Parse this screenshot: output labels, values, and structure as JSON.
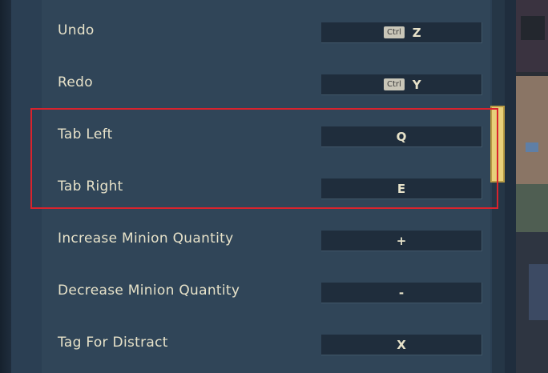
{
  "keybindings": [
    {
      "label": "Undo",
      "modifier": "Ctrl",
      "key": "Z"
    },
    {
      "label": "Redo",
      "modifier": "Ctrl",
      "key": "Y"
    },
    {
      "label": "Tab Left",
      "modifier": "",
      "key": "Q"
    },
    {
      "label": "Tab Right",
      "modifier": "",
      "key": "E"
    },
    {
      "label": "Increase Minion Quantity",
      "modifier": "",
      "key": "+"
    },
    {
      "label": "Decrease Minion Quantity",
      "modifier": "",
      "key": "-"
    },
    {
      "label": "Tag For Distract",
      "modifier": "",
      "key": "X"
    }
  ],
  "colors": {
    "panel": "#2b3f53",
    "key_box": "#1f2d3c",
    "text": "#e7e2c9",
    "scroll_thumb": "#e8d07a",
    "highlight": "#d9232d"
  },
  "icons": {
    "scrollbar": "scrollbar-thumb"
  }
}
